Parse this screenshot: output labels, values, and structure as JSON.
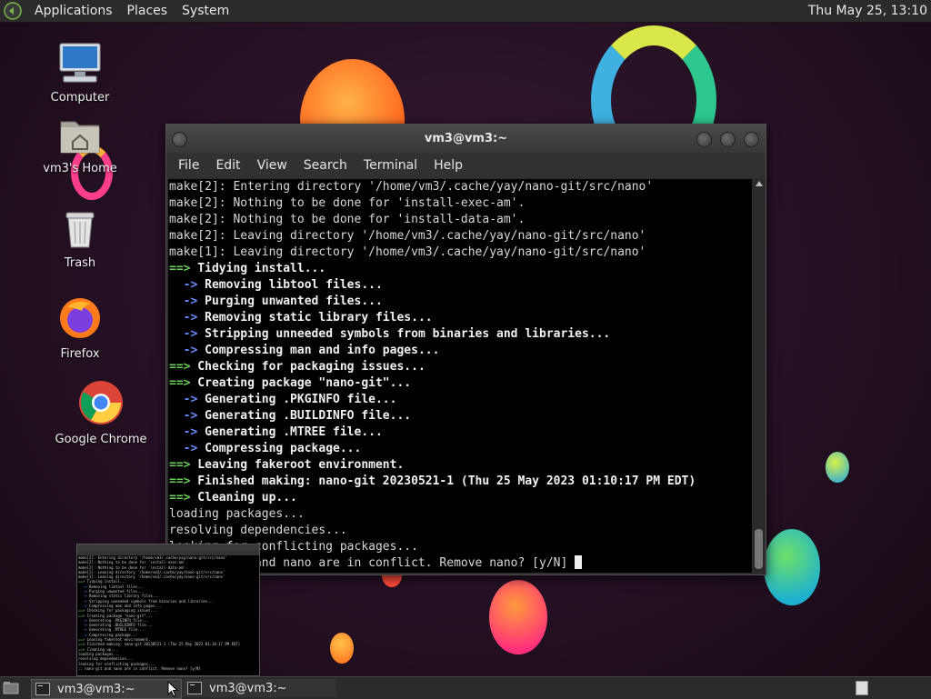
{
  "top_panel": {
    "menus": [
      "Applications",
      "Places",
      "System"
    ],
    "clock": "Thu May 25, 13:10"
  },
  "desktop_icons": [
    {
      "label": "Computer",
      "icon": "computer-icon"
    },
    {
      "label": "vm3's Home",
      "icon": "home-folder-icon"
    },
    {
      "label": "Trash",
      "icon": "trash-icon"
    },
    {
      "label": "Firefox",
      "icon": "firefox-icon"
    },
    {
      "label": "Google Chrome",
      "icon": "chrome-icon"
    }
  ],
  "terminal": {
    "title": "vm3@vm3:~",
    "menu": [
      "File",
      "Edit",
      "View",
      "Search",
      "Terminal",
      "Help"
    ],
    "lines": [
      {
        "kind": "plain",
        "text": "make[2]: Entering directory '/home/vm3/.cache/yay/nano-git/src/nano'"
      },
      {
        "kind": "plain",
        "text": "make[2]: Nothing to be done for 'install-exec-am'."
      },
      {
        "kind": "plain",
        "text": "make[2]: Nothing to be done for 'install-data-am'."
      },
      {
        "kind": "plain",
        "text": "make[2]: Leaving directory '/home/vm3/.cache/yay/nano-git/src/nano'"
      },
      {
        "kind": "plain",
        "text": "make[1]: Leaving directory '/home/vm3/.cache/yay/nano-git/src/nano'"
      },
      {
        "kind": "green",
        "prefix": "==>",
        "text": " Tidying install..."
      },
      {
        "kind": "blue",
        "prefix": "  ->",
        "text": " Removing libtool files..."
      },
      {
        "kind": "blue",
        "prefix": "  ->",
        "text": " Purging unwanted files..."
      },
      {
        "kind": "blue",
        "prefix": "  ->",
        "text": " Removing static library files..."
      },
      {
        "kind": "blue",
        "prefix": "  ->",
        "text": " Stripping unneeded symbols from binaries and libraries..."
      },
      {
        "kind": "blue",
        "prefix": "  ->",
        "text": " Compressing man and info pages..."
      },
      {
        "kind": "green",
        "prefix": "==>",
        "text": " Checking for packaging issues..."
      },
      {
        "kind": "green",
        "prefix": "==>",
        "text": " Creating package \"nano-git\"..."
      },
      {
        "kind": "blue",
        "prefix": "  ->",
        "text": " Generating .PKGINFO file..."
      },
      {
        "kind": "blue",
        "prefix": "  ->",
        "text": " Generating .BUILDINFO file..."
      },
      {
        "kind": "blue",
        "prefix": "  ->",
        "text": " Generating .MTREE file..."
      },
      {
        "kind": "blue",
        "prefix": "  ->",
        "text": " Compressing package..."
      },
      {
        "kind": "green",
        "prefix": "==>",
        "text": " Leaving fakeroot environment."
      },
      {
        "kind": "green",
        "prefix": "==>",
        "text": " Finished making: nano-git 20230521-1 (Thu 25 May 2023 01:10:17 PM EDT)"
      },
      {
        "kind": "green",
        "prefix": "==>",
        "text": " Cleaning up..."
      },
      {
        "kind": "plain",
        "text": "loading packages..."
      },
      {
        "kind": "plain",
        "text": "resolving dependencies..."
      },
      {
        "kind": "plain",
        "text": "looking for conflicting packages..."
      },
      {
        "kind": "plain",
        "text": ":: nano-git and nano are in conflict. Remove nano? [y/N] "
      }
    ]
  },
  "taskbar": {
    "items": [
      {
        "label": "vm3@vm3:~",
        "active": true
      },
      {
        "label": "vm3@vm3:~",
        "active": false
      }
    ]
  },
  "colors": {
    "prompt_green": "#6ad05a",
    "prompt_blue": "#6a8cff",
    "panel": "#2b2b2b"
  }
}
